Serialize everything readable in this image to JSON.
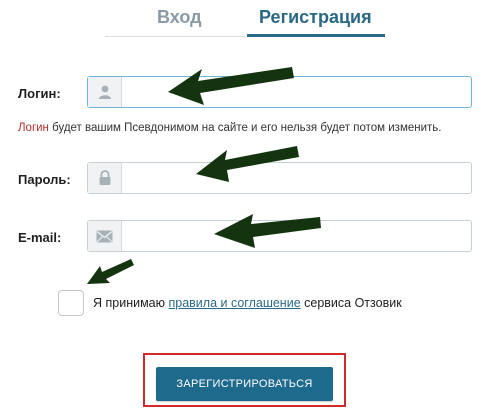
{
  "tabs": {
    "login": "Вход",
    "register": "Регистрация",
    "active": "register"
  },
  "form": {
    "login": {
      "label": "Логин:",
      "icon": "user-icon",
      "value": ""
    },
    "hint": {
      "strong": "Логин",
      "text": " будет вашим Псевдонимом на сайте и его нельзя будет потом изменить."
    },
    "password": {
      "label": "Пароль:",
      "icon": "lock-icon",
      "value": ""
    },
    "email": {
      "label": "E-mail:",
      "icon": "envelope-icon",
      "value": ""
    },
    "agreement": {
      "checked": false,
      "prefix": "Я принимаю ",
      "link": "правила и соглашение",
      "suffix": " сервиса Отзовик"
    },
    "submit_label": "ЗАРЕГИСТРИРОВАТЬСЯ"
  },
  "colors": {
    "accent": "#2a6985",
    "button": "#1e6a8d",
    "annotation_arrow": "#13340f",
    "annotation_frame": "#d22a2a",
    "hint_highlight": "#b6322a"
  }
}
